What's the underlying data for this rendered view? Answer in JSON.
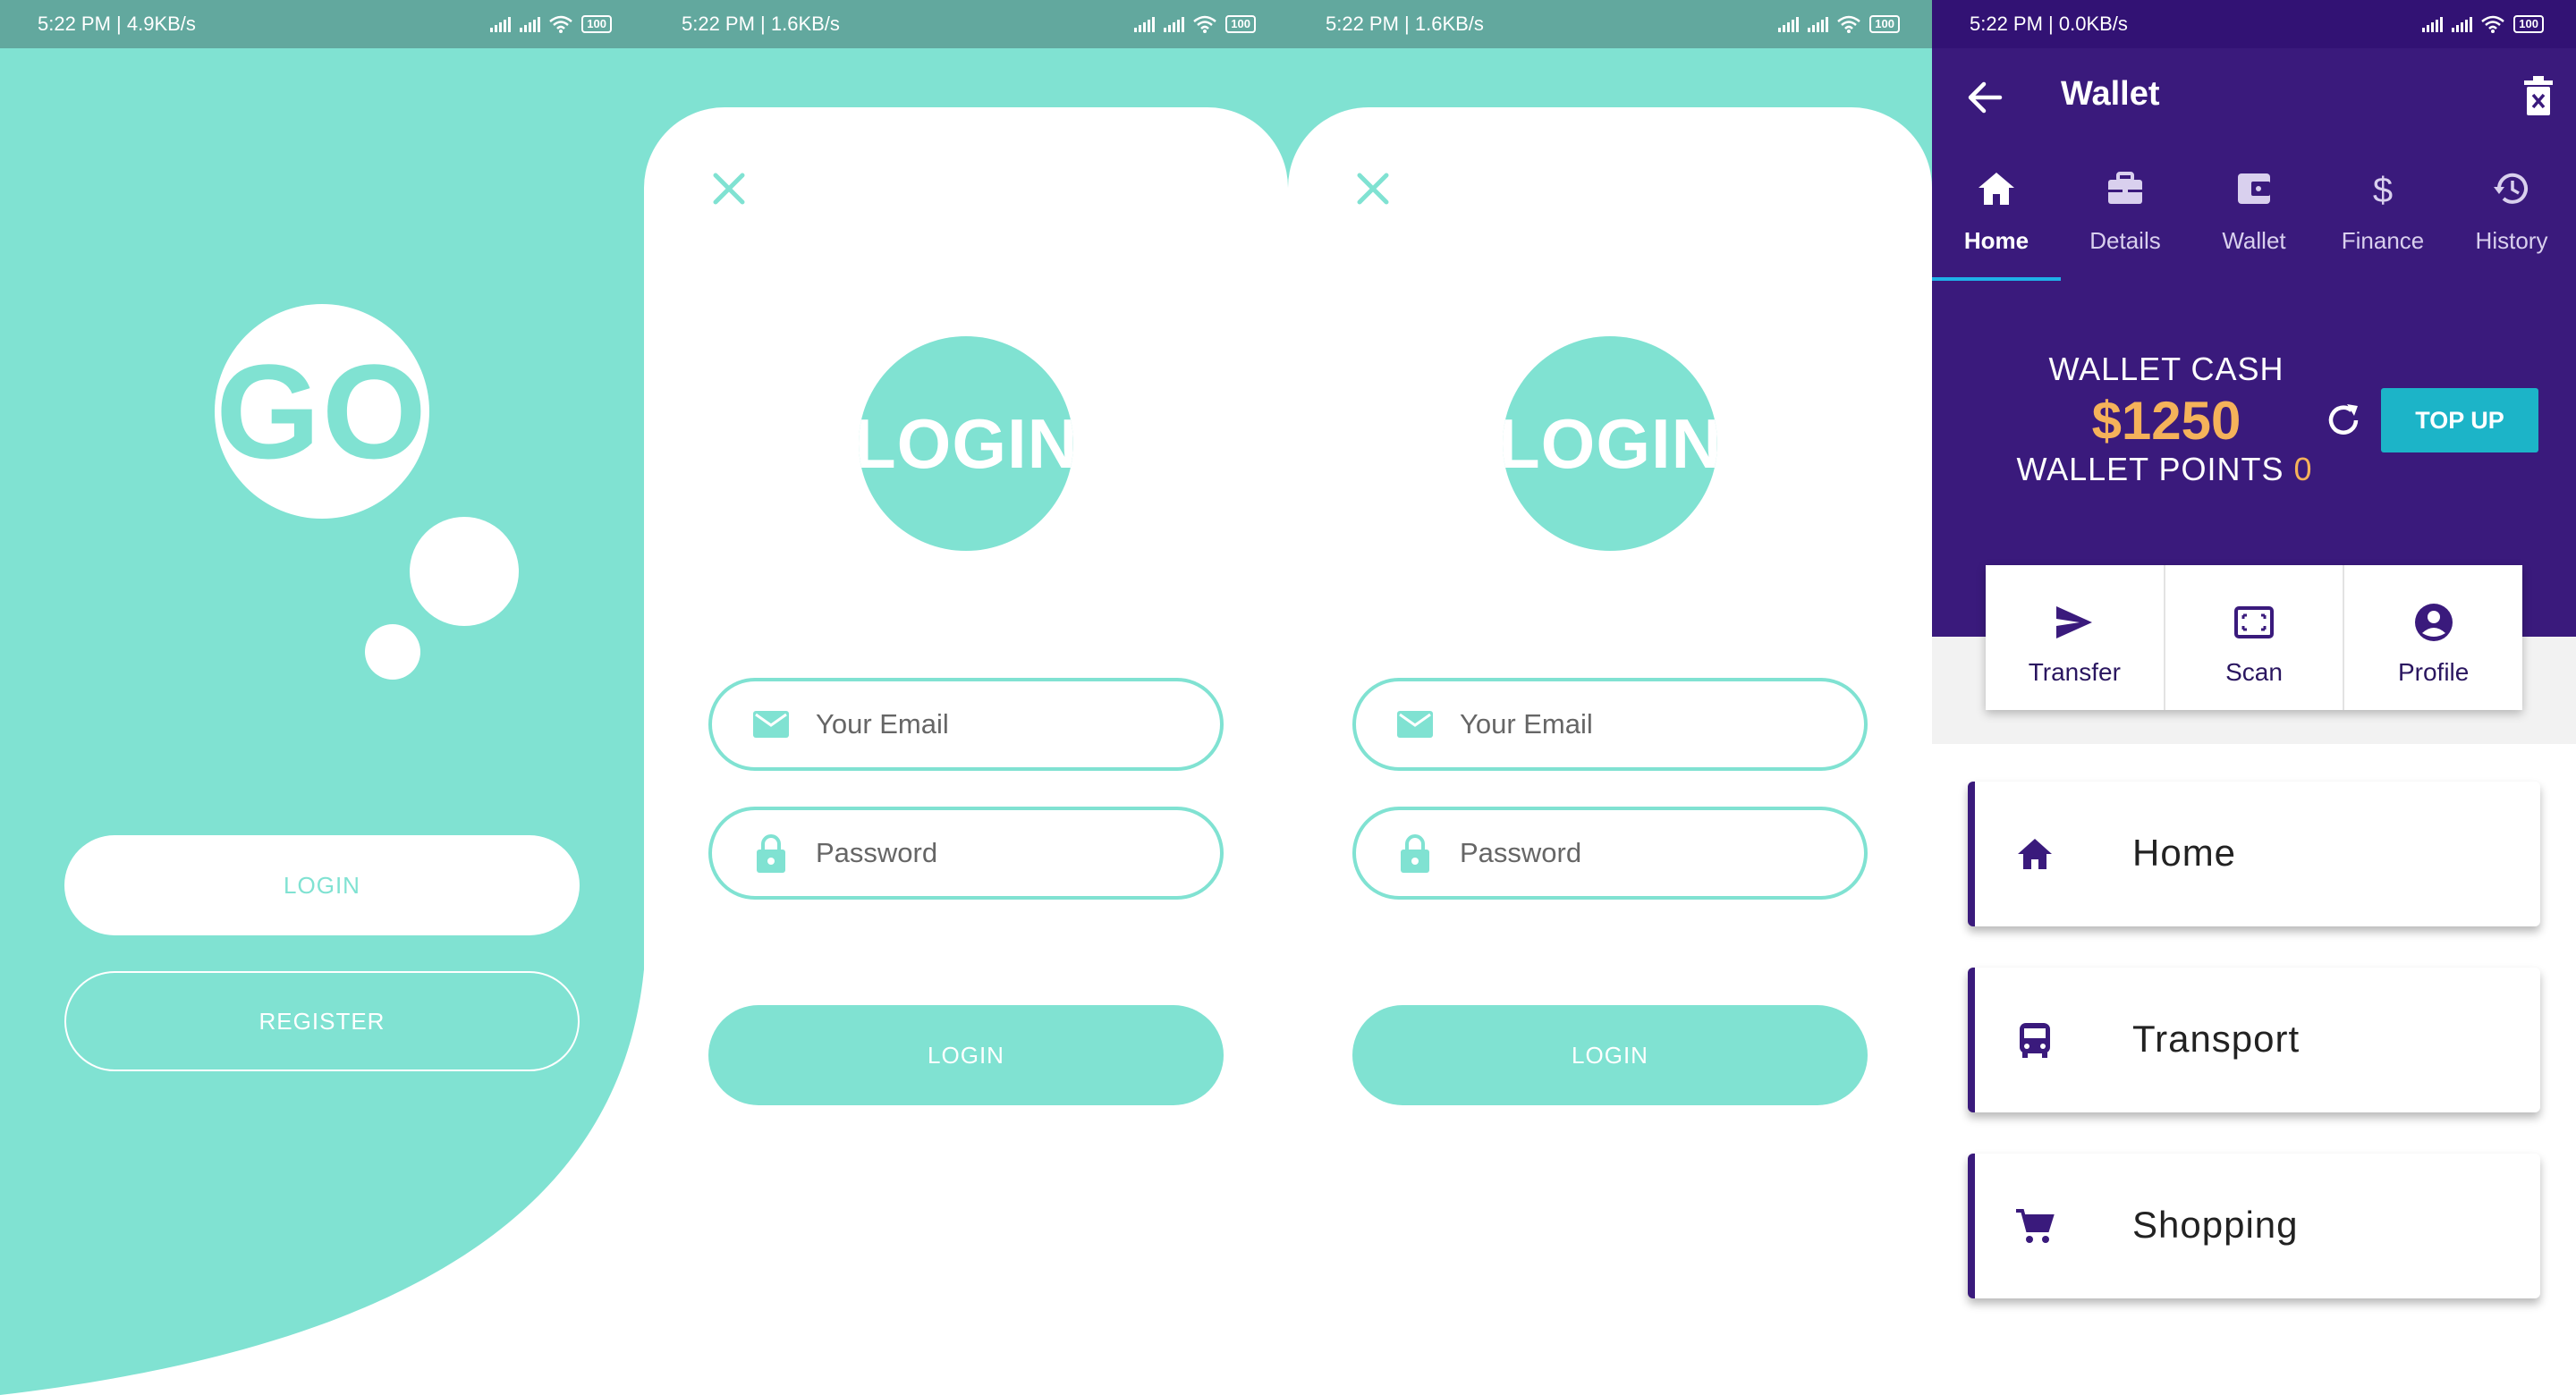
{
  "screens": [
    {
      "statusbar": {
        "time": "5:22 PM | 4.9KB/s",
        "battery": "100"
      },
      "logo_text": "GO",
      "login_button": "LOGIN",
      "register_button": "REGISTER"
    },
    {
      "statusbar": {
        "time": "5:22 PM | 1.6KB/s",
        "battery": "100"
      },
      "close_icon": "close-icon",
      "logo_text": "LOGIN",
      "email_placeholder": "Your Email",
      "password_placeholder": "Password",
      "login_button": "LOGIN"
    },
    {
      "statusbar": {
        "time": "5:22 PM | 1.6KB/s",
        "battery": "100"
      },
      "close_icon": "close-icon",
      "logo_text": "LOGIN",
      "email_placeholder": "Your Email",
      "password_placeholder": "Password",
      "login_button": "LOGIN"
    },
    {
      "statusbar": {
        "time": "5:22 PM | 0.0KB/s",
        "battery": "100"
      },
      "title": "Wallet",
      "tabs": [
        {
          "label": "Home",
          "icon": "home-icon",
          "active": true
        },
        {
          "label": "Details",
          "icon": "briefcase-icon",
          "active": false
        },
        {
          "label": "Wallet",
          "icon": "wallet-icon",
          "active": false
        },
        {
          "label": "Finance",
          "icon": "dollar-icon",
          "active": false
        },
        {
          "label": "History",
          "icon": "history-icon",
          "active": false
        }
      ],
      "wallet_cash_label": "WALLET CASH",
      "wallet_cash_amount": "$1250",
      "wallet_points_label": "WALLET POINTS",
      "wallet_points_value": "0",
      "topup_button": "TOP UP",
      "actions": [
        {
          "label": "Transfer",
          "icon": "send-icon"
        },
        {
          "label": "Scan",
          "icon": "scan-icon"
        },
        {
          "label": "Profile",
          "icon": "profile-icon"
        }
      ],
      "menu": [
        {
          "label": "Home",
          "icon": "home-icon"
        },
        {
          "label": "Transport",
          "icon": "bus-icon"
        },
        {
          "label": "Shopping",
          "icon": "cart-icon"
        }
      ]
    }
  ],
  "colors": {
    "teal": "#80e2d2",
    "teal_statusbar": "#62a89e",
    "purple": "#3a1a7c",
    "accent_gold": "#f5b25a",
    "topup_cyan": "#1cb4c8",
    "tab_indicator": "#1fb1e8"
  }
}
